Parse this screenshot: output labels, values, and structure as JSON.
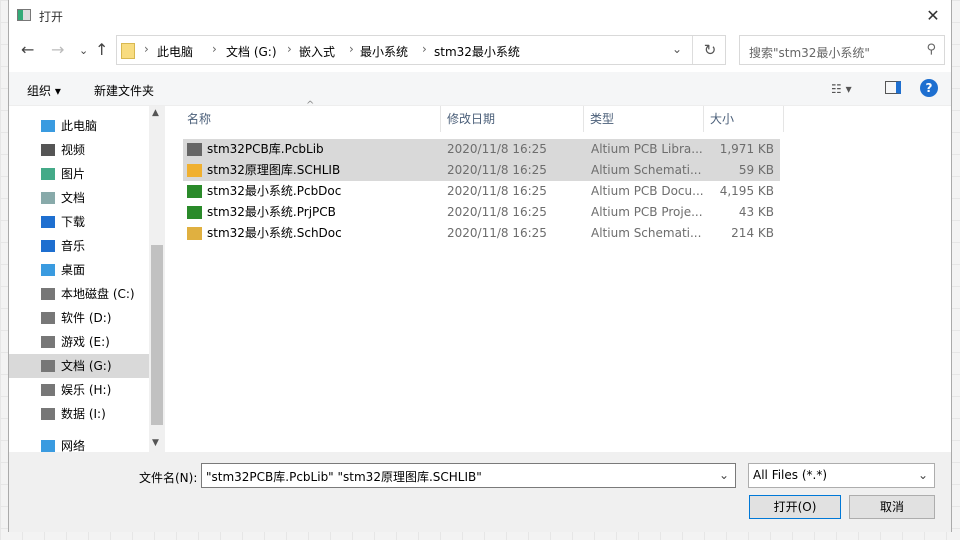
{
  "window": {
    "title": "打开"
  },
  "nav": {
    "back": "←",
    "forward": "→",
    "recent": "⌄",
    "up": "↑",
    "refresh": "↻",
    "breadcrumb": [
      "此电脑",
      "文档 (G:)",
      "嵌入式",
      "最小系统",
      "stm32最小系统"
    ],
    "search_placeholder": "搜索\"stm32最小系统\""
  },
  "toolbar": {
    "organize": "组织 ▾",
    "new_folder": "新建文件夹"
  },
  "sidebar": {
    "items": [
      {
        "label": "此电脑",
        "icon": "computer-icon",
        "color": "#3a9be0"
      },
      {
        "label": "视频",
        "icon": "video-icon",
        "color": "#555"
      },
      {
        "label": "图片",
        "icon": "pictures-icon",
        "color": "#4a8"
      },
      {
        "label": "文档",
        "icon": "documents-icon",
        "color": "#8aa"
      },
      {
        "label": "下载",
        "icon": "download-icon",
        "color": "#1e6fd0"
      },
      {
        "label": "音乐",
        "icon": "music-icon",
        "color": "#1e6fd0"
      },
      {
        "label": "桌面",
        "icon": "desktop-icon",
        "color": "#3a9be0"
      },
      {
        "label": "本地磁盘 (C:)",
        "icon": "drive-icon",
        "color": "#777"
      },
      {
        "label": "软件 (D:)",
        "icon": "drive-icon",
        "color": "#777"
      },
      {
        "label": "游戏 (E:)",
        "icon": "drive-icon",
        "color": "#777"
      },
      {
        "label": "文档 (G:)",
        "icon": "drive-icon",
        "color": "#777"
      },
      {
        "label": "娱乐 (H:)",
        "icon": "drive-icon",
        "color": "#777"
      },
      {
        "label": "数据 (I:)",
        "icon": "drive-icon",
        "color": "#777"
      },
      {
        "label": "网络",
        "icon": "network-icon",
        "color": "#3a9be0"
      }
    ]
  },
  "columns": {
    "name": "名称",
    "date": "修改日期",
    "type": "类型",
    "size": "大小"
  },
  "files": [
    {
      "name": "stm32PCB库.PcbLib",
      "date": "2020/11/8 16:25",
      "type": "Altium PCB Libra...",
      "size": "1,971 KB",
      "color": "#666"
    },
    {
      "name": "stm32原理图库.SCHLIB",
      "date": "2020/11/8 16:25",
      "type": "Altium Schemati...",
      "size": "59 KB",
      "color": "#f0b030"
    },
    {
      "name": "stm32最小系统.PcbDoc",
      "date": "2020/11/8 16:25",
      "type": "Altium PCB Docu...",
      "size": "4,195 KB",
      "color": "#2a8a2a"
    },
    {
      "name": "stm32最小系统.PrjPCB",
      "date": "2020/11/8 16:25",
      "type": "Altium PCB Proje...",
      "size": "43 KB",
      "color": "#2a8a2a"
    },
    {
      "name": "stm32最小系统.SchDoc",
      "date": "2020/11/8 16:25",
      "type": "Altium Schemati...",
      "size": "214 KB",
      "color": "#e0b040"
    }
  ],
  "footer": {
    "filename_label": "文件名(N):",
    "filename_value": "\"stm32PCB库.PcbLib\" \"stm32原理图库.SCHLIB\"",
    "filter": "All Files (*.*)",
    "open": "打开(O)",
    "cancel": "取消"
  }
}
